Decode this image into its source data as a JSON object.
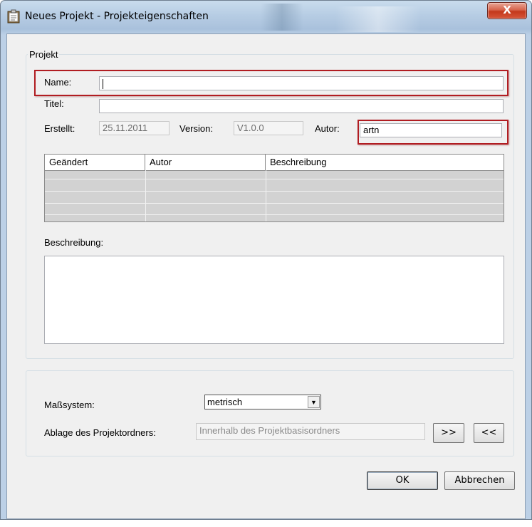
{
  "window": {
    "title": "Neues Projekt - Projekteigenschaften",
    "close_glyph": "X"
  },
  "projekt": {
    "legend": "Projekt",
    "name_label": "Name:",
    "name_value": "",
    "titel_label": "Titel:",
    "titel_value": "",
    "erstellt_label": "Erstellt:",
    "erstellt_value": "25.11.2011",
    "version_label": "Version:",
    "version_value": "V1.0.0",
    "autor_label": "Autor:",
    "autor_value": "artn",
    "history_columns": [
      "Geändert",
      "Autor",
      "Beschreibung"
    ],
    "beschreibung_label": "Beschreibung:",
    "beschreibung_value": ""
  },
  "settings": {
    "masssystem_label": "Maßsystem:",
    "masssystem_value": "metrisch",
    "ablage_label": "Ablage des Projektordners:",
    "ablage_value": "Innerhalb des Projektbasisordners",
    "forward_button": ">>",
    "back_button": "<<"
  },
  "buttons": {
    "ok": "OK",
    "cancel": "Abbrechen"
  },
  "colors": {
    "highlight": "#b11d22",
    "close_red": "#c3381c"
  }
}
